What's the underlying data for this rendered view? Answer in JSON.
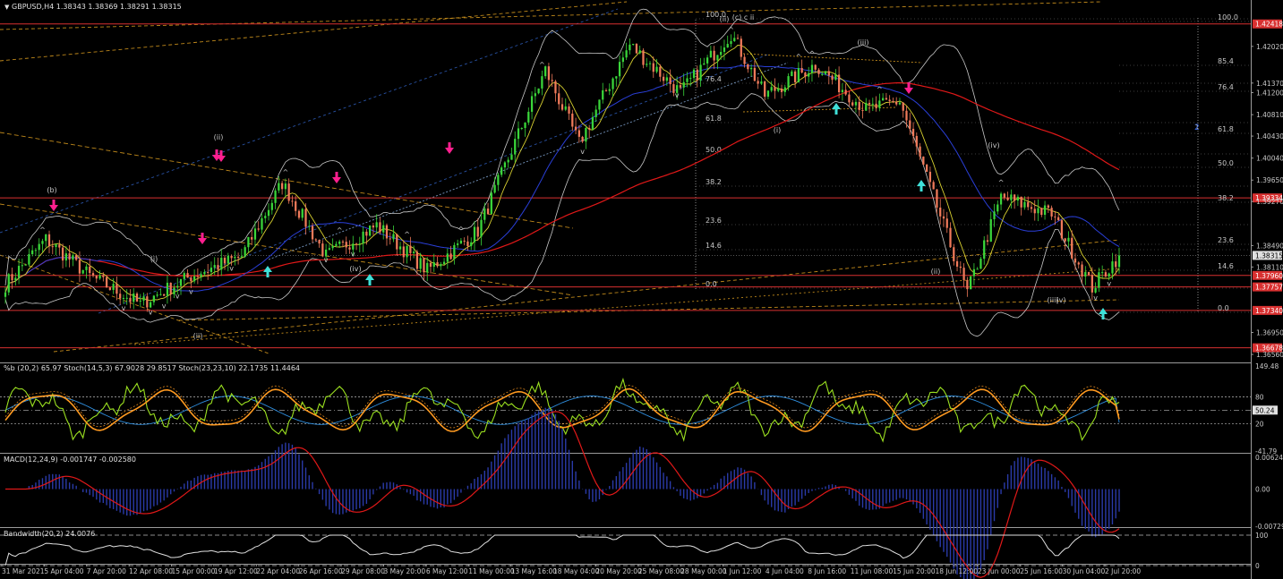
{
  "window": {
    "title": "GBPUSD,H4  1.38343 1.38369 1.38291 1.38315",
    "menu_triangle": "triangle-down-icon"
  },
  "colors": {
    "background": "#000000",
    "bull": "#3ad63a",
    "bear": "#f07a5a",
    "ma_long": "#e01818",
    "ma_mid": "#2a3fd8",
    "ma_fast": "#d8d030",
    "band": "#c8c8c8",
    "hline": "#d83030",
    "trend": "#e0a020",
    "channel": "#3060c0",
    "down_arrow": "#ff1f8f",
    "up_arrow": "#3fe0d8",
    "stoch_fast": "#9be020",
    "stoch_slow": "#ff9a20",
    "pctb": "#2f8fe0",
    "macd_hist": "#2a3aa8",
    "macd_signal": "#e01818",
    "bandwidth": "#e0e0e0"
  },
  "chart_data": [
    {
      "type": "candlestick",
      "symbol": "GBPUSD",
      "timeframe": "H4",
      "ohlc_header": {
        "open": 1.38343,
        "high": 1.38369,
        "low": 1.38291,
        "close": 1.38315
      },
      "y_ticks": [
        "1.42418",
        "1.42020",
        "1.41370",
        "1.41200",
        "1.40810",
        "1.40430",
        "1.40040",
        "1.39334",
        "1.39650",
        "1.39270",
        "1.38490",
        "1.38315",
        "1.38110",
        "1.37960",
        "1.37757",
        "1.37340",
        "1.36950",
        "1.36678",
        "1.36560"
      ],
      "highlighted_levels": [
        {
          "label": "1.42418",
          "value": 1.42418
        },
        {
          "label": "1.39334",
          "value": 1.39334
        },
        {
          "label": "1.37960",
          "value": 1.3796
        },
        {
          "label": "1.37757",
          "value": 1.37757
        },
        {
          "label": "1.37340",
          "value": 1.3734
        },
        {
          "label": "1.36678",
          "value": 1.36678
        }
      ],
      "current_price": {
        "label": "1.38315",
        "value": 1.38315
      },
      "x_ticks": [
        "31 Mar 2021",
        "5 Apr 04:00",
        "7 Apr 20:00",
        "12 Apr 08:00",
        "15 Apr 00:00",
        "19 Apr 12:00",
        "22 Apr 04:00",
        "26 Apr 16:00",
        "29 Apr 08:00",
        "3 May 20:00",
        "6 May 12:00",
        "11 May 00:00",
        "13 May 16:00",
        "18 May 04:00",
        "20 May 20:00",
        "25 May 08:00",
        "28 May 00:00",
        "1 Jun 12:00",
        "4 Jun 04:00",
        "8 Jun 16:00",
        "11 Jun 08:00",
        "15 Jun 20:00",
        "18 Jun 12:00",
        "23 Jun 00:00",
        "25 Jun 16:00",
        "30 Jun 04:00",
        "2 Jul 20:00"
      ],
      "close_path": [
        {
          "t": 0,
          "p": 1.378
        },
        {
          "t": 12,
          "p": 1.386
        },
        {
          "t": 25,
          "p": 1.3795
        },
        {
          "t": 40,
          "p": 1.3745
        },
        {
          "t": 55,
          "p": 1.3795
        },
        {
          "t": 70,
          "p": 1.383
        },
        {
          "t": 82,
          "p": 1.396
        },
        {
          "t": 95,
          "p": 1.383
        },
        {
          "t": 110,
          "p": 1.3885
        },
        {
          "t": 125,
          "p": 1.3805
        },
        {
          "t": 140,
          "p": 1.3875
        },
        {
          "t": 160,
          "p": 1.416
        },
        {
          "t": 170,
          "p": 1.403
        },
        {
          "t": 185,
          "p": 1.4205
        },
        {
          "t": 200,
          "p": 1.412
        },
        {
          "t": 215,
          "p": 1.4225
        },
        {
          "t": 225,
          "p": 1.4115
        },
        {
          "t": 240,
          "p": 1.417
        },
        {
          "t": 255,
          "p": 1.409
        },
        {
          "t": 265,
          "p": 1.4105
        },
        {
          "t": 275,
          "p": 1.3935
        },
        {
          "t": 285,
          "p": 1.3765
        },
        {
          "t": 295,
          "p": 1.3935
        },
        {
          "t": 310,
          "p": 1.3905
        },
        {
          "t": 322,
          "p": 1.3775
        },
        {
          "t": 330,
          "p": 1.38315
        }
      ],
      "fib_levels": [
        "100.0",
        "85.4",
        "76.4",
        "61.8",
        "50.0",
        "38.2",
        "23.6",
        "14.6",
        "0.0"
      ],
      "fib_left_levels": [
        "100.0",
        "76.4",
        "61.8",
        "50.0",
        "38.2",
        "23.6",
        "14.6",
        "0.0"
      ],
      "wave_labels": [
        "(b)",
        "(ii)",
        "(i)",
        "(ii)",
        "(iv)",
        "(i)",
        "(ii)",
        "(iii)",
        "(ii)",
        "(iv)",
        "(iii)",
        "(v)",
        "1",
        "2",
        "(c) c ii"
      ]
    },
    {
      "type": "line",
      "title": "%b (20,2) 65.97  Stoch(14,5,3) 67.9028 29.8517  Stoch(23,23,10) 22.1735 11.4464",
      "y_ticks": [
        "149.48",
        "80",
        "50.24",
        "20",
        "-41.79"
      ],
      "series": [
        {
          "name": "%b (20,2)",
          "last": 65.97
        },
        {
          "name": "Stoch(14,5,3)",
          "last": 67.9028
        },
        {
          "name": "Stoch(23,23,10)",
          "last": 22.1735
        }
      ]
    },
    {
      "type": "bar",
      "title": "MACD(12,24,9) -0.001747 -0.002580",
      "y_ticks": [
        "0.006247",
        "0.00",
        "-0.007292"
      ],
      "series": [
        {
          "name": "MACD(12,24,9)",
          "last": -0.001747
        },
        {
          "name": "Signal",
          "last": -0.00258
        }
      ]
    },
    {
      "type": "line",
      "title": "Bandwidth(20,2) 24.0076",
      "y_ticks": [
        "100",
        "0"
      ],
      "series": [
        {
          "name": "Bandwidth(20,2)",
          "last": 24.0076
        }
      ]
    }
  ],
  "side_label": "2"
}
